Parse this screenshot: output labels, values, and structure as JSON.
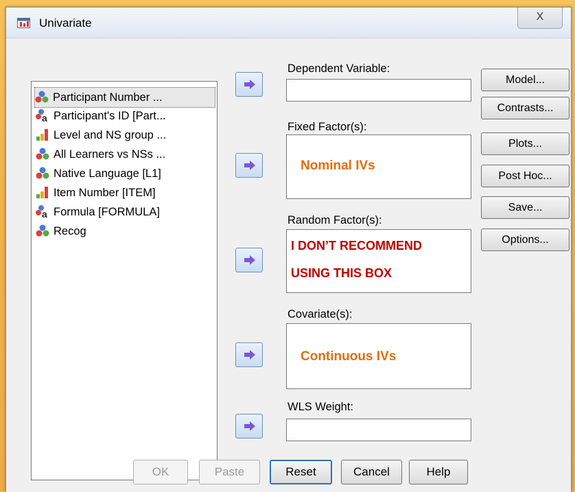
{
  "window": {
    "title": "Univariate",
    "close_glyph": "X"
  },
  "variables": [
    {
      "label": "Participant Number ...",
      "icon": "nominal-icon",
      "selected": true
    },
    {
      "label": "Participant's ID [Part...",
      "icon": "nominal-string-icon"
    },
    {
      "label": "Level and NS group ...",
      "icon": "ordinal-icon"
    },
    {
      "label": "All Learners vs NSs ...",
      "icon": "nominal-icon"
    },
    {
      "label": "Native Language [L1]",
      "icon": "nominal-icon"
    },
    {
      "label": "Item Number [ITEM]",
      "icon": "ordinal-icon"
    },
    {
      "label": "Formula [FORMULA]",
      "icon": "nominal-string-icon"
    },
    {
      "label": "Recog",
      "icon": "nominal-icon"
    }
  ],
  "targets": {
    "dependent": {
      "label": "Dependent Variable:",
      "value": ""
    },
    "fixed": {
      "label": "Fixed Factor(s):",
      "note": "Nominal IVs"
    },
    "random": {
      "label": "Random Factor(s):",
      "note_line1": "I DON’T RECOMMEND",
      "note_line2": "USING THIS BOX"
    },
    "covariate": {
      "label": "Covariate(s):",
      "note": "Continuous  IVs"
    },
    "wls": {
      "label": "WLS Weight:",
      "value": ""
    }
  },
  "side_buttons": [
    "Model...",
    "Contrasts...",
    "Plots...",
    "Post Hoc...",
    "Save...",
    "Options..."
  ],
  "bottom_buttons": {
    "ok": "OK",
    "paste": "Paste",
    "reset": "Reset",
    "cancel": "Cancel",
    "help": "Help"
  },
  "colors": {
    "note_orange": "#e46c0a",
    "note_red": "#c00000",
    "background": "#f2b24a"
  }
}
